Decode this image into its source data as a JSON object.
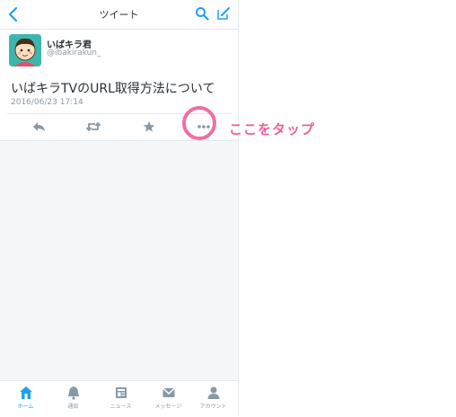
{
  "header": {
    "title": "ツイート",
    "icons": [
      "back-chevron-icon",
      "search-icon",
      "compose-icon"
    ],
    "accent_color": "#1da1f2"
  },
  "tweet": {
    "display_name": "いばキラ君",
    "handle": "@ibakirakun_",
    "text": "いばキラTVのURL取得方法について",
    "timestamp": "2016/06/23 17:14",
    "actions": [
      "reply-icon",
      "retweet-icon",
      "favorite-icon",
      "more-options-icon"
    ]
  },
  "annotation": {
    "text": "ここをタップ",
    "color": "#ef5d9b"
  },
  "tabbar": {
    "items": [
      {
        "label": "ホーム",
        "icon": "home-icon",
        "active": true
      },
      {
        "label": "通知",
        "icon": "notifications-icon",
        "active": false
      },
      {
        "label": "ニュース",
        "icon": "news-icon",
        "active": false
      },
      {
        "label": "メッセージ",
        "icon": "messages-icon",
        "active": false
      },
      {
        "label": "アカウント",
        "icon": "account-icon",
        "active": false
      }
    ]
  }
}
